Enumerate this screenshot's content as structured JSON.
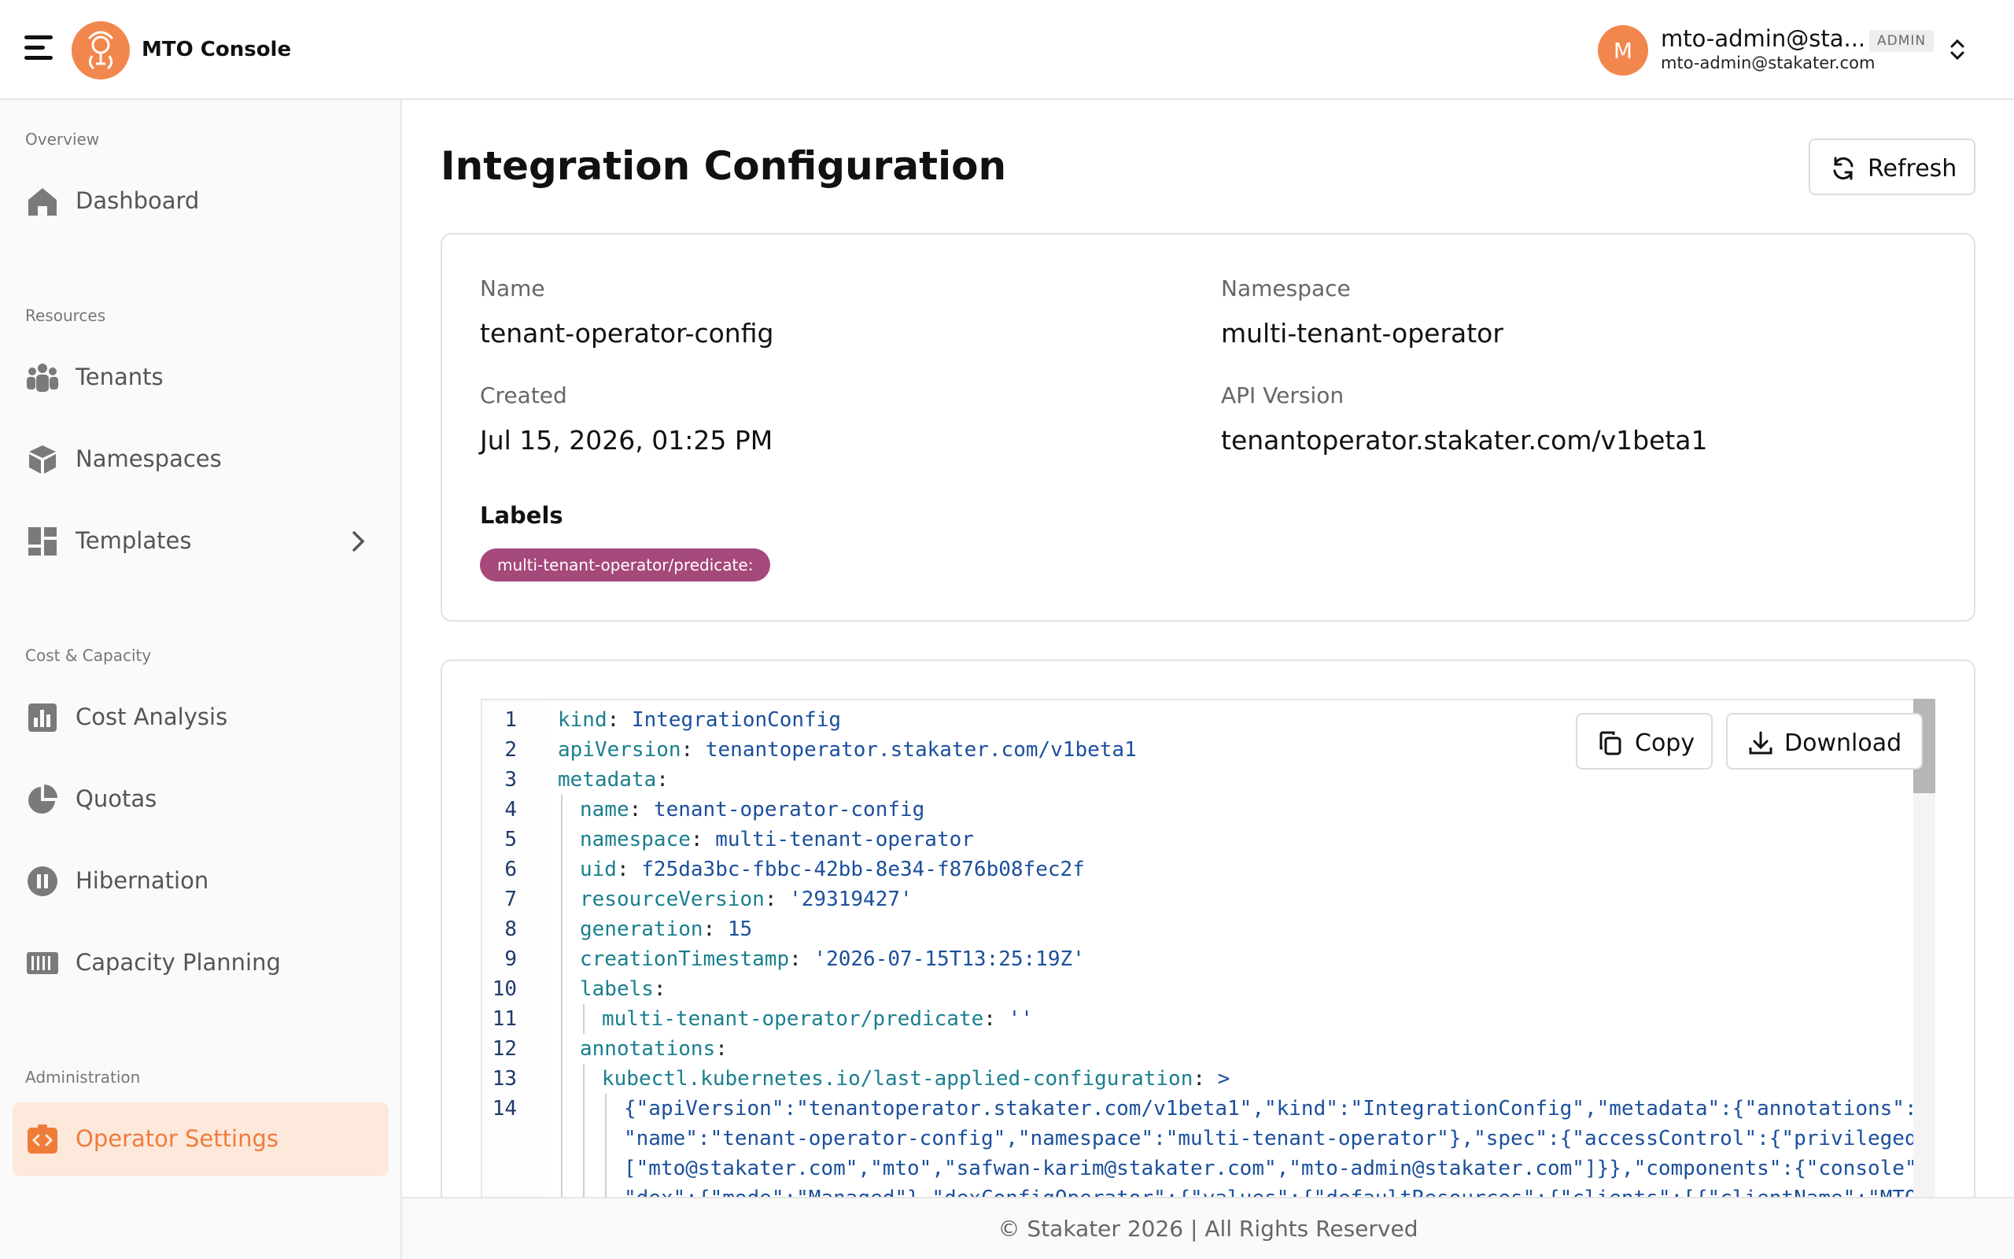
{
  "app": {
    "name": "MTO Console"
  },
  "user": {
    "avatar_initial": "M",
    "name": "mto-admin@sta...",
    "badge": "ADMIN",
    "email": "mto-admin@stakater.com"
  },
  "sidebar": {
    "sections": [
      {
        "label": "Overview"
      },
      {
        "label": "Resources"
      },
      {
        "label": "Cost & Capacity"
      },
      {
        "label": "Administration"
      }
    ],
    "items": [
      {
        "label": "Dashboard"
      },
      {
        "label": "Tenants"
      },
      {
        "label": "Namespaces"
      },
      {
        "label": "Templates"
      },
      {
        "label": "Cost Analysis"
      },
      {
        "label": "Quotas"
      },
      {
        "label": "Hibernation"
      },
      {
        "label": "Capacity Planning"
      },
      {
        "label": "Operator Settings",
        "active": true
      }
    ]
  },
  "page": {
    "title": "Integration Configuration",
    "refresh_label": "Refresh"
  },
  "details": {
    "name_label": "Name",
    "name_value": "tenant-operator-config",
    "namespace_label": "Namespace",
    "namespace_value": "multi-tenant-operator",
    "created_label": "Created",
    "created_value": "Jul 15, 2026, 01:25 PM",
    "api_version_label": "API Version",
    "api_version_value": "tenantoperator.stakater.com/v1beta1",
    "labels_title": "Labels",
    "labels": [
      "multi-tenant-operator/predicate:"
    ]
  },
  "code": {
    "copy_label": "Copy",
    "download_label": "Download",
    "lines": [
      {
        "n": "1",
        "key": "kind",
        "val": "IntegrationConfig"
      },
      {
        "n": "2",
        "key": "apiVersion",
        "val": "tenantoperator.stakater.com/v1beta1"
      },
      {
        "n": "3",
        "key": "metadata",
        "val": ""
      },
      {
        "n": "4",
        "key": "name",
        "val": "tenant-operator-config"
      },
      {
        "n": "5",
        "key": "namespace",
        "val": "multi-tenant-operator"
      },
      {
        "n": "6",
        "key": "uid",
        "val": "f25da3bc-fbbc-42bb-8e34-f876b08fec2f"
      },
      {
        "n": "7",
        "key": "resourceVersion",
        "val": "'29319427'"
      },
      {
        "n": "8",
        "key": "generation",
        "val": "15"
      },
      {
        "n": "9",
        "key": "creationTimestamp",
        "val": "'2026-07-15T13:25:19Z'"
      },
      {
        "n": "10",
        "key": "labels",
        "val": ""
      },
      {
        "n": "11",
        "key": "multi-tenant-operator/predicate",
        "val": "''"
      },
      {
        "n": "12",
        "key": "annotations",
        "val": ""
      },
      {
        "n": "13",
        "key": "kubectl.kubernetes.io/last-applied-configuration",
        "val": ">"
      },
      {
        "n": "14",
        "key": "",
        "val": "{\"apiVersion\":\"tenantoperator.stakater.com/v1beta1\",\"kind\":\"IntegrationConfig\",\"metadata\":{\"annotations\":{},"
      },
      {
        "n": "",
        "key": "",
        "val": "\"name\":\"tenant-operator-config\",\"namespace\":\"multi-tenant-operator\"},\"spec\":{\"accessControl\":{\"privileged\":{\"users\":"
      },
      {
        "n": "",
        "key": "",
        "val": "[\"mto@stakater.com\",\"mto\",\"safwan-karim@stakater.com\",\"mto-admin@stakater.com\"]}},\"components\":{\"console\":true,"
      },
      {
        "n": "",
        "key": "",
        "val": "\"dex\":{\"mode\":\"Managed\"},\"dexConfigOperator\":{\"values\":{\"defaultResources\":{\"clients\":[{\"clientName\":\"MTO"
      }
    ]
  },
  "footer": {
    "text": "© Stakater 2026 | All Rights Reserved"
  }
}
